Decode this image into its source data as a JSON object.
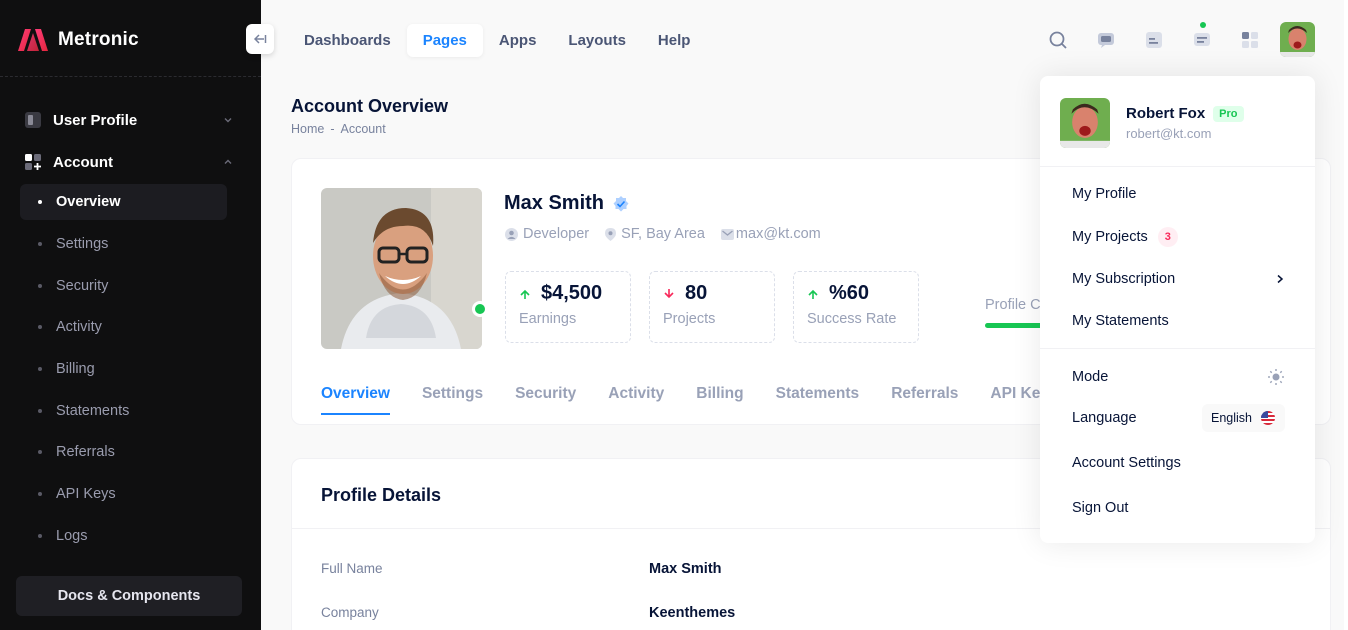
{
  "app": {
    "name": "Metronic"
  },
  "sidebar": {
    "sections": [
      {
        "label": "User Profile",
        "expanded": false
      },
      {
        "label": "Account",
        "expanded": true
      }
    ],
    "items": [
      {
        "label": "Overview",
        "active": true
      },
      {
        "label": "Settings"
      },
      {
        "label": "Security"
      },
      {
        "label": "Activity"
      },
      {
        "label": "Billing"
      },
      {
        "label": "Statements"
      },
      {
        "label": "Referrals"
      },
      {
        "label": "API Keys"
      },
      {
        "label": "Logs"
      }
    ],
    "docs_label": "Docs & Components"
  },
  "header": {
    "nav": [
      {
        "label": "Dashboards"
      },
      {
        "label": "Pages",
        "active": true
      },
      {
        "label": "Apps"
      },
      {
        "label": "Layouts"
      },
      {
        "label": "Help"
      }
    ],
    "icons": [
      "search-icon",
      "chat-icon",
      "inbox-icon",
      "notification-icon",
      "apps-grid-icon"
    ]
  },
  "page": {
    "title": "Account Overview",
    "breadcrumb": [
      "Home",
      "-",
      "Account"
    ]
  },
  "profile": {
    "name": "Max Smith",
    "role": "Developer",
    "location": "SF, Bay Area",
    "email": "max@kt.com",
    "stats": [
      {
        "value": "$4,500",
        "label": "Earnings",
        "trend": "up"
      },
      {
        "value": "80",
        "label": "Projects",
        "trend": "down"
      },
      {
        "value": "%60",
        "label": "Success Rate",
        "trend": "up"
      }
    ],
    "completion_label": "Profile C",
    "tabs": [
      {
        "label": "Overview",
        "active": true
      },
      {
        "label": "Settings"
      },
      {
        "label": "Security"
      },
      {
        "label": "Activity"
      },
      {
        "label": "Billing"
      },
      {
        "label": "Statements"
      },
      {
        "label": "Referrals"
      },
      {
        "label": "API Key"
      }
    ]
  },
  "details": {
    "title": "Profile Details",
    "rows": [
      {
        "key": "Full Name",
        "value": "Max Smith"
      },
      {
        "key": "Company",
        "value": "Keenthemes"
      }
    ]
  },
  "user_menu": {
    "name": "Robert Fox",
    "badge": "Pro",
    "email": "robert@kt.com",
    "items": [
      {
        "label": "My Profile"
      },
      {
        "label": "My Projects",
        "count": "3"
      },
      {
        "label": "My Subscription"
      },
      {
        "label": "My Statements"
      }
    ],
    "mode_label": "Mode",
    "language_label": "Language",
    "language_value": "English",
    "account_settings": "Account Settings",
    "sign_out": "Sign Out"
  },
  "colors": {
    "primary": "#1b84ff",
    "success": "#17c653",
    "danger": "#f8285a",
    "sidebar": "#0f0f10"
  }
}
